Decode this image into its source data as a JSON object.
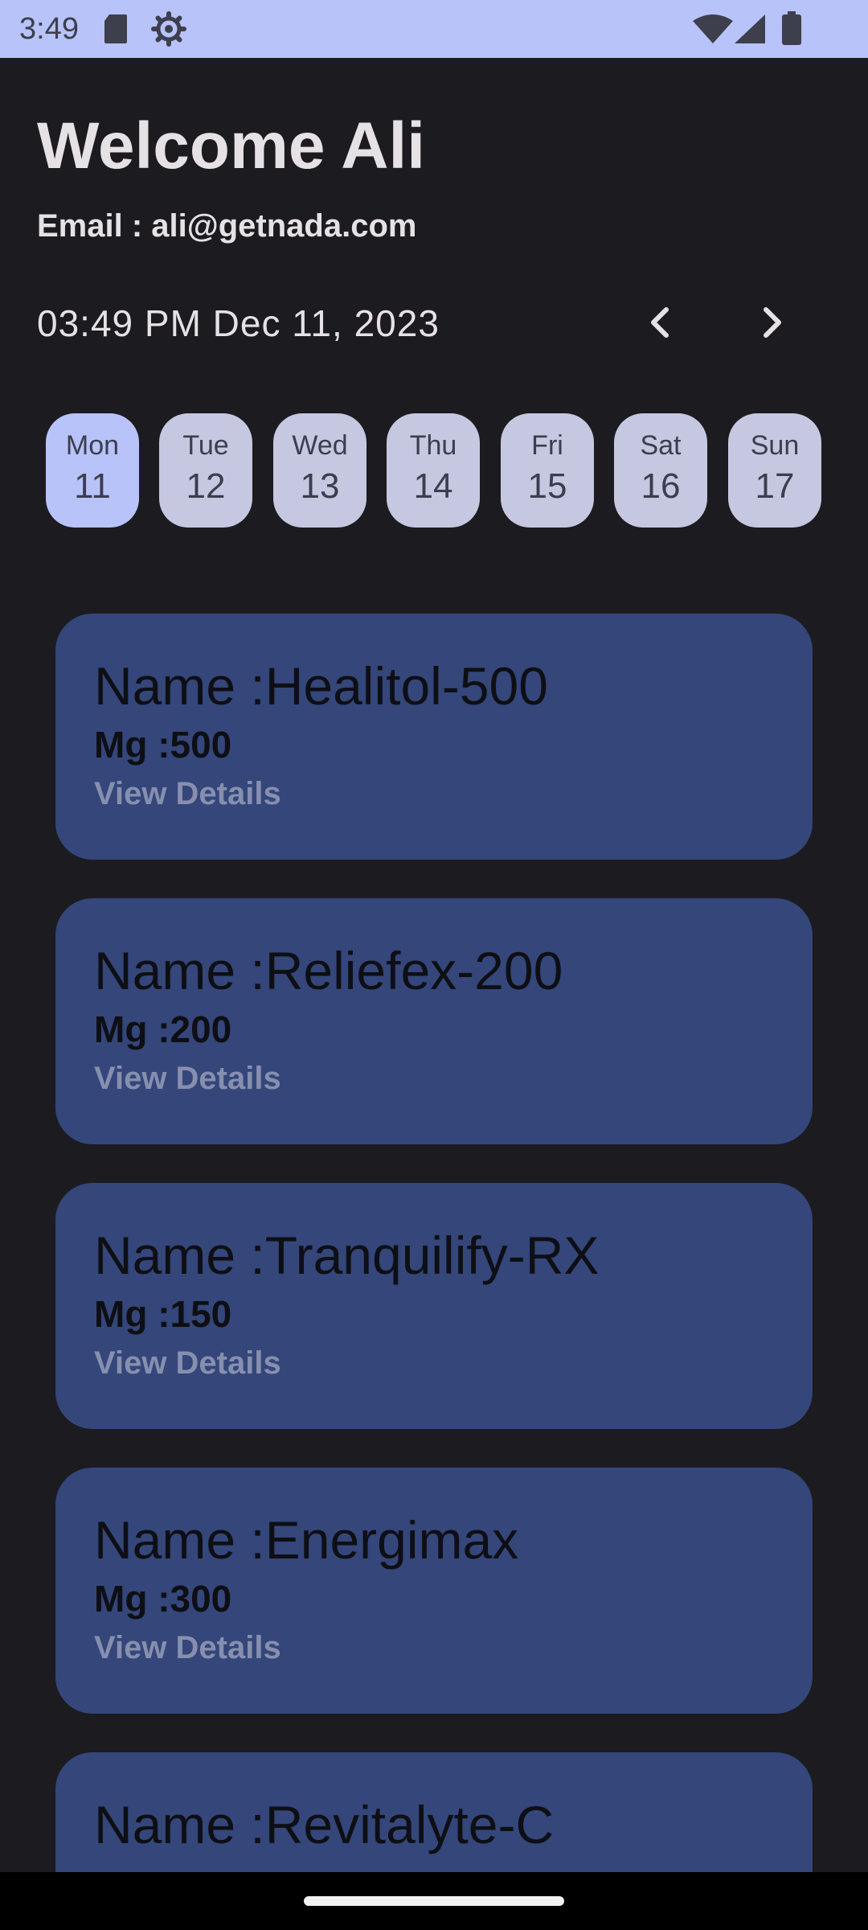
{
  "status_bar": {
    "time": "3:49",
    "icons": [
      "sd-card-icon",
      "settings-icon",
      "wifi-icon",
      "signal-icon",
      "battery-icon"
    ],
    "background": "#b8c3fa"
  },
  "header": {
    "welcome": "Welcome Ali",
    "email": "Email : ali@getnada.com"
  },
  "date_nav": {
    "datetime": "03:49 PM Dec 11, 2023",
    "prev_icon": "chevron-left-icon",
    "next_icon": "chevron-right-icon"
  },
  "week": {
    "days": [
      {
        "name": "Mon",
        "num": "11",
        "selected": true
      },
      {
        "name": "Tue",
        "num": "12",
        "selected": false
      },
      {
        "name": "Wed",
        "num": "13",
        "selected": false
      },
      {
        "name": "Thu",
        "num": "14",
        "selected": false
      },
      {
        "name": "Fri",
        "num": "15",
        "selected": false
      },
      {
        "name": "Sat",
        "num": "16",
        "selected": false
      },
      {
        "name": "Sun",
        "num": "17",
        "selected": false
      }
    ],
    "selected_color": "#b8c3fa",
    "default_color": "#c5c8e0"
  },
  "medicines": [
    {
      "name": "Name :Healitol-500",
      "mg": "Mg :500",
      "link": "View Details"
    },
    {
      "name": "Name :Reliefex-200",
      "mg": "Mg :200",
      "link": "View Details"
    },
    {
      "name": "Name :Tranquilify-RX",
      "mg": "Mg :150",
      "link": "View Details"
    },
    {
      "name": "Name :Energimax",
      "mg": "Mg :300",
      "link": "View Details"
    },
    {
      "name": "Name :Revitalyte-C",
      "mg": "",
      "link": ""
    }
  ],
  "colors": {
    "background": "#1c1b1f",
    "card": "#34467a",
    "link": "#868fae"
  }
}
